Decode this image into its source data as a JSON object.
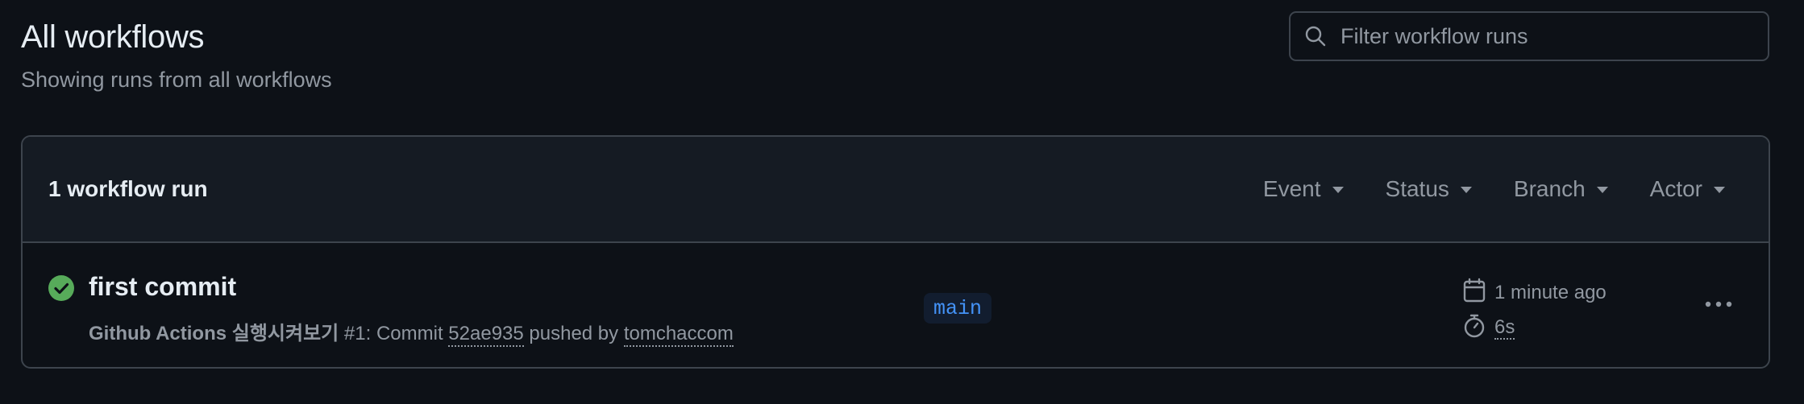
{
  "header": {
    "title": "All workflows",
    "subtitle": "Showing runs from all workflows"
  },
  "search": {
    "placeholder": "Filter workflow runs",
    "value": ""
  },
  "runs_list": {
    "count_label": "1 workflow run",
    "filters": [
      {
        "label": "Event"
      },
      {
        "label": "Status"
      },
      {
        "label": "Branch"
      },
      {
        "label": "Actor"
      }
    ],
    "runs": [
      {
        "title": "first commit",
        "workflow_name": "Github Actions 실행시켜보기",
        "run_number": "#1",
        "commit_prefix": ": Commit ",
        "commit_sha": "52ae935",
        "pushed_by_text": " pushed by ",
        "actor": "tomchaccom",
        "branch": "main",
        "time_ago": "1 minute ago",
        "duration": "6s",
        "status": "success",
        "status_icon": "check-circle-icon",
        "status_color": "#57ab5a"
      }
    ]
  },
  "colors": {
    "background": "#0d1117",
    "header_bg": "#151b23",
    "border": "#3d444d",
    "text_primary": "#e6edf3",
    "text_muted": "#9198a1",
    "accent": "#4493f8",
    "success": "#57ab5a"
  }
}
